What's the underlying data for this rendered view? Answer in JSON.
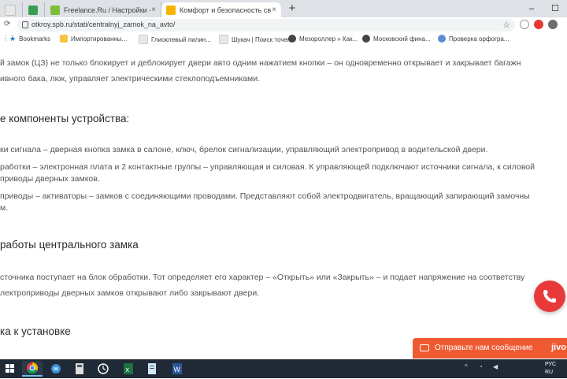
{
  "browser": {
    "tabs": [
      {
        "label": "",
        "icon": "page-icon"
      },
      {
        "label": "",
        "icon": "image-icon"
      },
      {
        "label": "Freelance.Ru / Настройки - Мой",
        "icon": "freelance-icon"
      },
      {
        "label": "Комфорт и безопасность своего",
        "icon": "site-icon",
        "active": true
      }
    ],
    "new_tab": "+",
    "window_controls": {
      "minimize": "–",
      "maximize": "☐"
    },
    "url": "otkroy.spb.ru/stati/centralnyj_zamok_na_avto/",
    "bookmarks": [
      {
        "label": "Bookmarks",
        "icon": "star-icon"
      },
      {
        "label": "Импортированны...",
        "icon": "folder-icon"
      },
      {
        "label": "Глиоклевый пилин...",
        "icon": "page-icon"
      },
      {
        "label": "Шукач | Поиск точек",
        "icon": "page-icon"
      },
      {
        "label": "Мезороллер » Как...",
        "icon": "page-icon"
      },
      {
        "label": "Московский фина...",
        "icon": "page-icon"
      },
      {
        "label": "Проверка орфогра...",
        "icon": "page-icon"
      }
    ]
  },
  "article": {
    "intro_line1": "й замок (ЦЗ) не только блокирует и деблокирует двери авто одним нажатием кнопки – он одновременно открывает и закрывает багажн",
    "intro_line2": "ивного бака, люк, управляет электрическими стеклоподъемниками.",
    "heading1": "е компоненты устройства:",
    "item1": "ки сигнала – дверная кнопка замка в салоне, ключ, брелок сигнализации, управляющий электропривод в водительской двери.",
    "item2_line1": "работки – электронная плата и 2 контактные группы – управляющая и силовая. К управляющей подключают источники сигнала, к силовой",
    "item2_line2": "приводы дверных замков.",
    "item3_line1": "приводы – активаторы – замков с соединяющими проводами. Представляют собой электродвигатель, вращающий запирающий замочны",
    "item3_line2": "м.",
    "heading2": "работы центрального замка",
    "para2_line1": "сточника поступает на блок обработки. Тот определяет его характер – «Открыть» или «Закрыть» – и подает напряжение на соответству",
    "para2_line2": "лектроприводы дверных замков открывают либо закрывают двери.",
    "heading3": "ка к установке"
  },
  "widgets": {
    "message_label": "Отправьте нам сообщение",
    "message_brand": "jivo",
    "accent_color": "#f05a32",
    "call_color": "#e83a3a"
  },
  "taskbar": {
    "apps": [
      "windows-icon",
      "search-icon",
      "chrome-icon",
      "network-icon",
      "calculator-icon",
      "clock-icon",
      "excel-icon",
      "notepad-icon",
      "word-icon"
    ],
    "lang": "РУС",
    "lang_sub": "RU"
  }
}
